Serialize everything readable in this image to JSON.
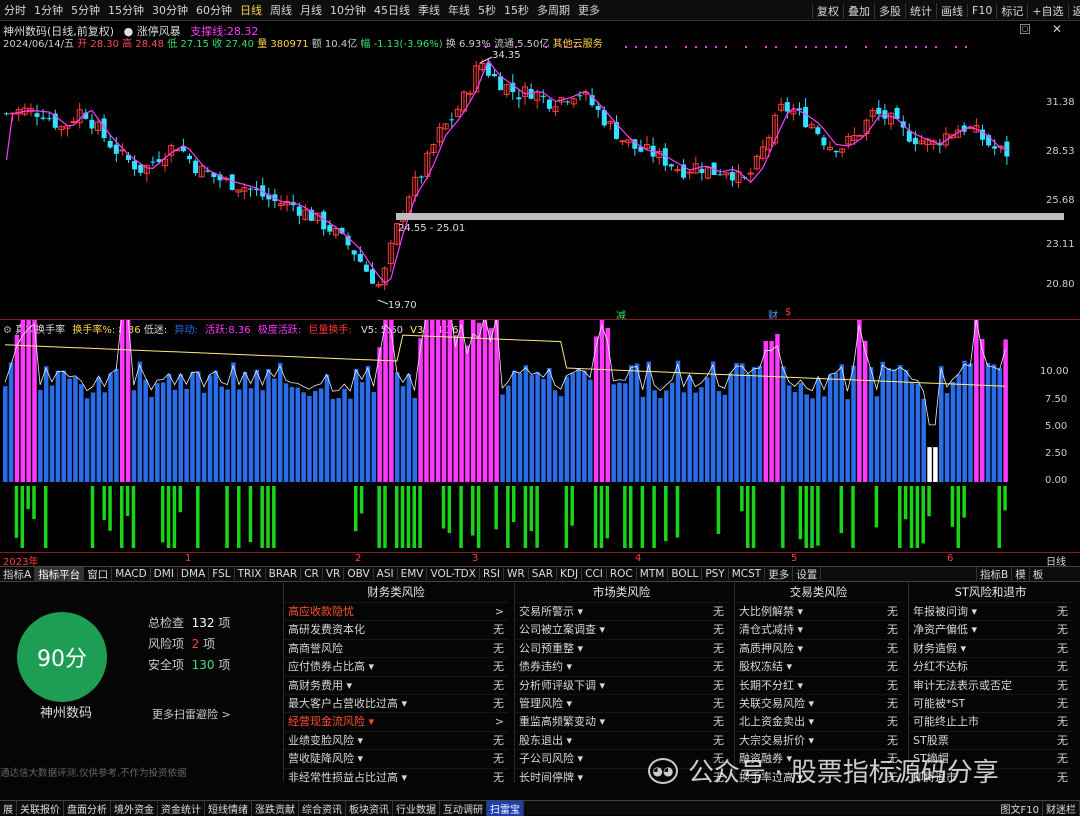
{
  "toolbar": {
    "periods": [
      "分时",
      "1分钟",
      "5分钟",
      "15分钟",
      "30分钟",
      "60分钟",
      "日线",
      "周线",
      "月线",
      "10分钟",
      "45日线",
      "季线",
      "年线",
      "5秒",
      "15秒",
      "多周期",
      "更多"
    ],
    "active_period": "日线",
    "right": [
      "复权",
      "叠加",
      "多股",
      "统计",
      "画线",
      "F10",
      "标记",
      "+自选",
      "返回"
    ]
  },
  "main_chart": {
    "stock_line": "神州数码(日线,前复权)",
    "zt_label": "涨停风暴",
    "support_label": "支撑线:",
    "support_value": "28.32",
    "date": "2024/06/14/五",
    "open": "开 28.30",
    "high": "高 28.48",
    "low": "低 27.15",
    "close": "收 27.40",
    "volume": "量 380971",
    "amount": "额 10.4亿",
    "change": "幅 -1.13(-3.96%)",
    "turnover": "换 6.93%",
    "float": "流通 5.50亿",
    "sector": "其他云服务",
    "y_ticks": [
      "31.38",
      "28.53",
      "25.68",
      "23.11",
      "20.80"
    ],
    "hi_label": "34.35",
    "lo_label": "19.70",
    "range_label": "24.55 - 25.01",
    "marker_1": "减",
    "marker_2": "财",
    "marker_3": "$"
  },
  "sub_chart": {
    "title_name": "真实换手率",
    "turn_label": "换手率%: 8.36",
    "low_label": "低迷:",
    "abn_label": "异动:",
    "active_label": "活跃:8.36",
    "extreme_label": "极度活跃:",
    "huge_label": "巨量换手:",
    "v5": "V5: 5.60",
    "v35": "V35: 4.36",
    "y_ticks": [
      "10.00",
      "7.50",
      "5.00",
      "2.50",
      "0.00"
    ]
  },
  "x_axis": {
    "labels": [
      "2023年",
      "1",
      "2",
      "3",
      "4",
      "5",
      "6"
    ],
    "period": "日线"
  },
  "indicator_bar": {
    "items": [
      "指标A",
      "指标平台",
      "窗口",
      "MACD",
      "DMI",
      "DMA",
      "FSL",
      "TRIX",
      "BRAR",
      "CR",
      "VR",
      "OBV",
      "ASI",
      "EMV",
      "VOL-TDX",
      "RSI",
      "WR",
      "SAR",
      "KDJ",
      "CCI",
      "ROC",
      "MTM",
      "BOLL",
      "PSY",
      "MCST",
      "更多",
      "设置"
    ],
    "active": "指标平台",
    "right": [
      "指标B",
      "模",
      "板"
    ]
  },
  "score": {
    "value": "90分",
    "name": "神州数码",
    "total_label": "总检查",
    "total": "132",
    "total_unit": "项",
    "risk_label": "风险项",
    "risk": "2",
    "risk_unit": "项",
    "safe_label": "安全项",
    "safe": "130",
    "safe_unit": "项",
    "more": "更多扫雷避险 >",
    "footnote": "通达信大数据评测,仅供参考,不作为投资依据"
  },
  "columns": [
    {
      "title": "财务类风险",
      "rows": [
        {
          "label": "高应收款隐忧",
          "value": ">",
          "flag": "red"
        },
        {
          "label": "高研发费资本化",
          "value": "无",
          "flag": ""
        },
        {
          "label": "高商誉风险",
          "value": "无",
          "flag": ""
        },
        {
          "label": "应付债券占比高 ▾",
          "value": "无",
          "flag": ""
        },
        {
          "label": "高财务费用 ▾",
          "value": "无",
          "flag": ""
        },
        {
          "label": "最大客户占营收比过高 ▾",
          "value": "无",
          "flag": ""
        },
        {
          "label": "经营现金流风险 ▾",
          "value": ">",
          "flag": "red"
        },
        {
          "label": "业绩变脸风险 ▾",
          "value": "无",
          "flag": ""
        },
        {
          "label": "营收陡降风险 ▾",
          "value": "无",
          "flag": ""
        },
        {
          "label": "非经常性损益占比过高 ▾",
          "value": "无",
          "flag": ""
        }
      ]
    },
    {
      "title": "市场类风险",
      "rows": [
        {
          "label": "交易所警示 ▾",
          "value": "无",
          "flag": ""
        },
        {
          "label": "公司被立案调查 ▾",
          "value": "无",
          "flag": ""
        },
        {
          "label": "公司预重整 ▾",
          "value": "无",
          "flag": ""
        },
        {
          "label": "债券违约 ▾",
          "value": "无",
          "flag": ""
        },
        {
          "label": "分析师评级下调 ▾",
          "value": "无",
          "flag": ""
        },
        {
          "label": "管理风险 ▾",
          "value": "无",
          "flag": ""
        },
        {
          "label": "重监高频繁变动 ▾",
          "value": "无",
          "flag": ""
        },
        {
          "label": "股东退出 ▾",
          "value": "无",
          "flag": ""
        },
        {
          "label": "子公司风险 ▾",
          "value": "无",
          "flag": ""
        },
        {
          "label": "长时间停牌 ▾",
          "value": "无",
          "flag": ""
        }
      ]
    },
    {
      "title": "交易类风险",
      "rows": [
        {
          "label": "大比例解禁 ▾",
          "value": "无",
          "flag": ""
        },
        {
          "label": "清仓式减持 ▾",
          "value": "无",
          "flag": ""
        },
        {
          "label": "高质押风险 ▾",
          "value": "无",
          "flag": ""
        },
        {
          "label": "股权冻结 ▾",
          "value": "无",
          "flag": ""
        },
        {
          "label": "长期不分红 ▾",
          "value": "无",
          "flag": ""
        },
        {
          "label": "关联交易风险 ▾",
          "value": "无",
          "flag": ""
        },
        {
          "label": "北上资金卖出 ▾",
          "value": "无",
          "flag": ""
        },
        {
          "label": "大宗交易折价 ▾",
          "value": "无",
          "flag": ""
        },
        {
          "label": "融资融券 ▾",
          "value": "无",
          "flag": ""
        },
        {
          "label": "换手率过高 ▾",
          "value": "无",
          "flag": ""
        }
      ]
    },
    {
      "title": "ST风险和退市",
      "rows": [
        {
          "label": "年报被问询 ▾",
          "value": "无",
          "flag": ""
        },
        {
          "label": "净资产偏低 ▾",
          "value": "无",
          "flag": ""
        },
        {
          "label": "财务造假 ▾",
          "value": "无",
          "flag": ""
        },
        {
          "label": "分红不达标",
          "value": "无",
          "flag": ""
        },
        {
          "label": "审计无法表示或否定",
          "value": "无",
          "flag": ""
        },
        {
          "label": "可能被*ST",
          "value": "无",
          "flag": ""
        },
        {
          "label": "可能终止上市",
          "value": "无",
          "flag": ""
        },
        {
          "label": "ST股票",
          "value": "无",
          "flag": ""
        },
        {
          "label": "ST摘帽",
          "value": "无",
          "flag": ""
        },
        {
          "label": "即将退市",
          "value": "无",
          "flag": ""
        }
      ]
    }
  ],
  "bottom_tabs": {
    "items": [
      "展",
      "关联报价",
      "盘面分析",
      "境外资金",
      "资金统计",
      "短线情绪",
      "涨跌贡献",
      "综合资讯",
      "板块资讯",
      "行业数据",
      "互动调研",
      "扫雷宝"
    ],
    "active": "扫雷宝",
    "right": "图文F10",
    "right2": "财迷栏"
  },
  "watermark": "公众号 · 股票指标源码分享",
  "colors": {
    "up": "#ff3d3d",
    "down": "#33e0ff",
    "ma": "#ff3cff",
    "vol_low": "#2b6de8",
    "vol_high": "#ff38ff",
    "vol_neg": "#19d419",
    "avg": "#ffeb7a"
  }
}
